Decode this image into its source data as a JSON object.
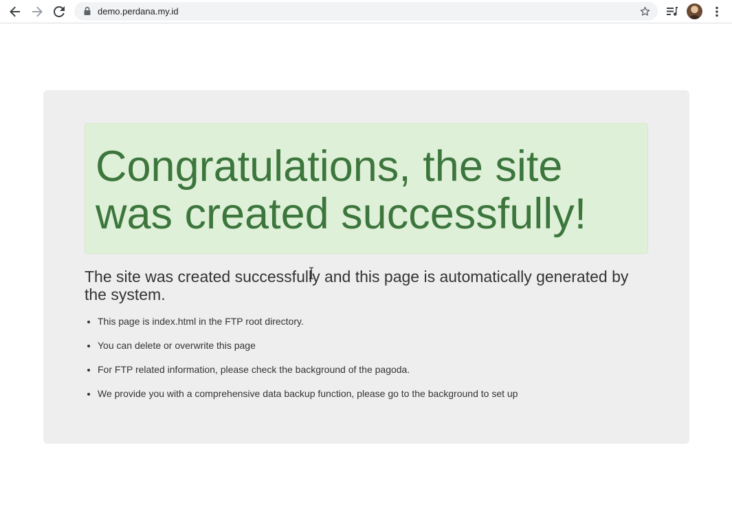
{
  "browser": {
    "url": "demo.perdana.my.id",
    "icons": {
      "back": "arrow-left-icon",
      "forward": "arrow-right-icon",
      "reload": "reload-icon",
      "lock": "lock-icon",
      "bookmark": "star-icon",
      "media": "media-control-icon",
      "profile": "avatar",
      "menu": "kebab-menu-icon"
    }
  },
  "page": {
    "heading": "Congratulations, the site was created successfully!",
    "intro": "The site was created successfully and this page is automatically generated by the system.",
    "items": [
      "This page is index.html in the FTP root directory.",
      "You can delete or overwrite this page",
      "For FTP related information, please check the background of the pagoda.",
      "We provide you with a comprehensive data backup function, please go to the background to set up"
    ]
  },
  "colors": {
    "panel_bg": "#eeeeee",
    "alert_bg": "#dff0d8",
    "alert_border": "#d6e9c6",
    "alert_text": "#3c763d",
    "body_text": "#333333"
  }
}
